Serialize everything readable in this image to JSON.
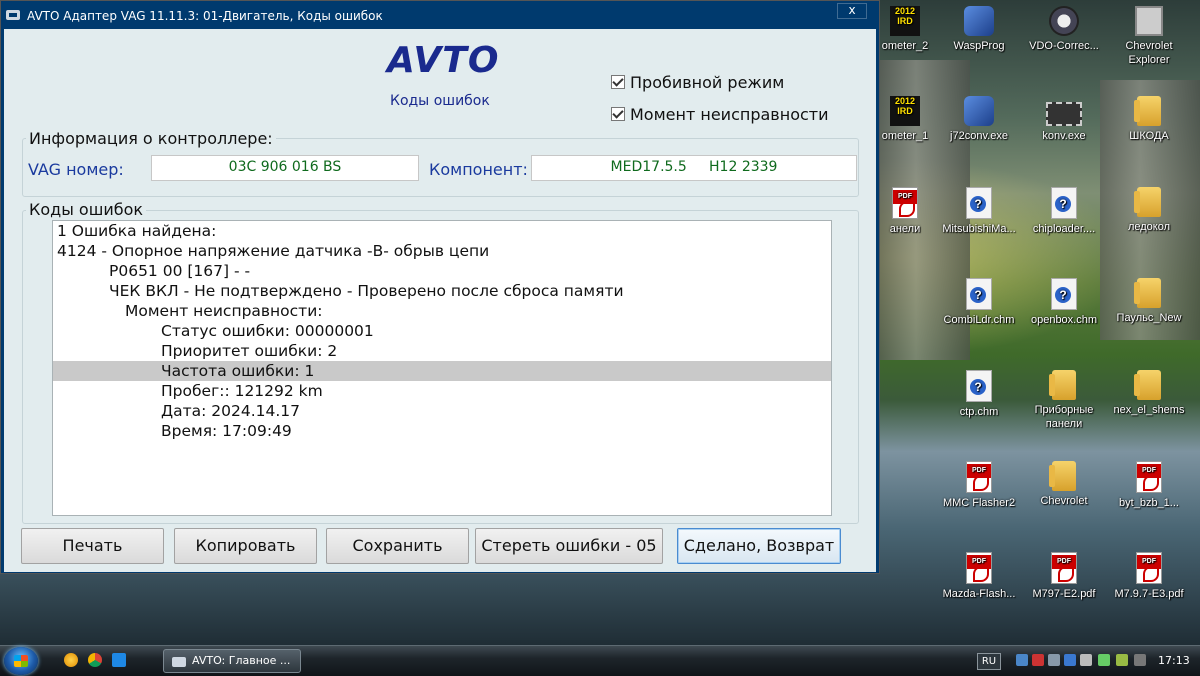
{
  "window": {
    "title": "AVTO Адаптер VAG 11.11.3: 01-Двигатель, Коды ошибок",
    "close_label": "x",
    "logo": "AVTO",
    "subtitle": "Коды ошибок"
  },
  "options": [
    {
      "label": "Пробивной режим",
      "checked": true
    },
    {
      "label": "Момент неисправности",
      "checked": true
    }
  ],
  "controller_info": {
    "group_label": "Информация о контроллере:",
    "vag_label": "VAG номер:",
    "vag_value": "03C 906 016 BS",
    "component_label": "Компонент:",
    "component_value": "MED17.5.5     H12 2339"
  },
  "fault_codes": {
    "group_label": "Коды ошибок",
    "lines": [
      "1 Ошибка найдена:",
      "4124 - Опорное напряжение датчика -B- обрыв цепи",
      "P0651 00 [167] - -",
      "ЧЕК ВКЛ - Не подтверждено - Проверено после сброса памяти",
      "Момент неисправности:",
      "Статус ошибки: 00000001",
      "Приоритет ошибки: 2",
      "Частота ошибки: 1",
      "Пробег:: 121292 km",
      "Дата: 2024.14.17",
      "Время: 17:09:49"
    ],
    "selected_index": 7
  },
  "buttons": {
    "print": "Печать",
    "copy": "Копировать",
    "save": "Сохранить",
    "clear": "Стереть ошибки - 05",
    "done": "Сделано, Возврат"
  },
  "desktop_icons": [
    {
      "label": "ometer_2",
      "icon": "app-badge-icon"
    },
    {
      "label": "WaspProg",
      "icon": "wasp-app-icon"
    },
    {
      "label": "VDO-Correc...",
      "icon": "gauge-icon"
    },
    {
      "label": "Chevrolet Explorer",
      "icon": "chevrolet-badge-icon"
    },
    {
      "label": "ometer_1",
      "icon": "app-badge-icon"
    },
    {
      "label": "j72conv.exe",
      "icon": "app-icon"
    },
    {
      "label": "konv.exe",
      "icon": "chip-icon"
    },
    {
      "label": "ШКОДА",
      "icon": "folder-icon"
    },
    {
      "label": "анели",
      "icon": "pdf-icon"
    },
    {
      "label": "MitsubishiMa...",
      "icon": "help-file-icon"
    },
    {
      "label": "chiploader....",
      "icon": "help-file-icon"
    },
    {
      "label": "ледокол",
      "icon": "folder-icon"
    },
    {
      "label": "CombiLdr.chm",
      "icon": "help-file-icon"
    },
    {
      "label": "openbox.chm",
      "icon": "help-file-icon"
    },
    {
      "label": "Паульс_New",
      "icon": "folder-icon"
    },
    {
      "label": "ctp.chm",
      "icon": "help-file-icon"
    },
    {
      "label": "Приборные панели",
      "icon": "folder-icon"
    },
    {
      "label": "nex_el_shems",
      "icon": "folder-icon"
    },
    {
      "label": "MMC Flasher2",
      "icon": "pdf-icon"
    },
    {
      "label": "Chevrolet",
      "icon": "folder-icon"
    },
    {
      "label": "byt_bzb_1...",
      "icon": "pdf-icon"
    },
    {
      "label": "Mazda-Flash...",
      "icon": "pdf-icon"
    },
    {
      "label": "M797-E2.pdf",
      "icon": "pdf-icon"
    },
    {
      "label": "M7.9.7-E3.pdf",
      "icon": "pdf-icon"
    }
  ],
  "badge_text": {
    "year": "2012",
    "code": "IRD"
  },
  "taskbar": {
    "task_label": "AVTO:  Главное ...",
    "language": "RU",
    "clock": "17:13"
  },
  "colors": {
    "title_bar": "#003a6e",
    "client_bg": "#e2ecee",
    "label_blue": "#1a3a9e",
    "value_green": "#0f6a1d",
    "selection": "#c9c9c9"
  }
}
